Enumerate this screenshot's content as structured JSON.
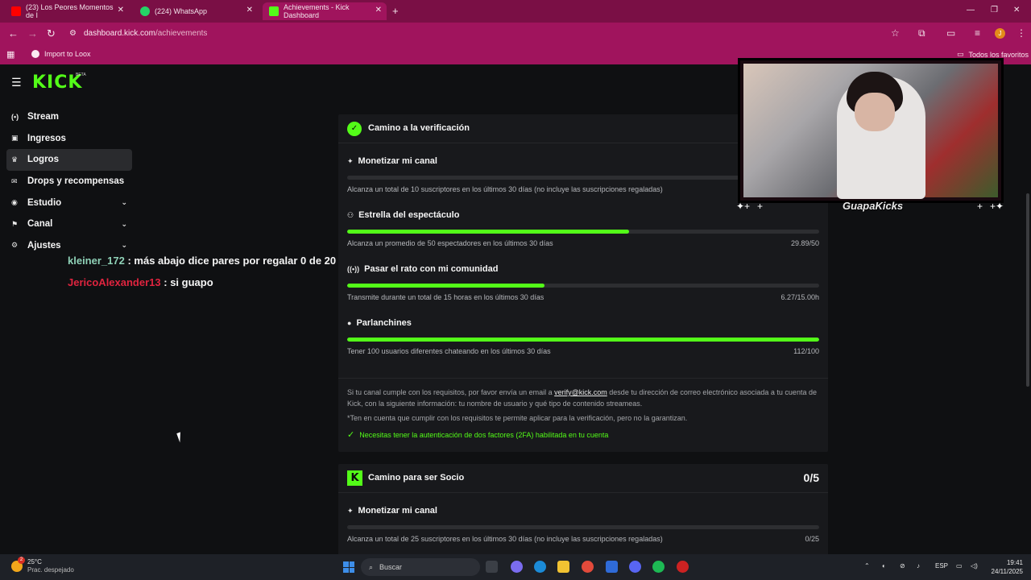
{
  "browser": {
    "tabs": [
      {
        "title": "(23) Los Peores Momentos de I",
        "icon": "youtube-icon"
      },
      {
        "title": "(224) WhatsApp",
        "icon": "whatsapp-icon"
      },
      {
        "title": "Achievements - Kick Dashboard",
        "icon": "kick-icon"
      }
    ],
    "new_tab": "+",
    "url_domain": "dashboard.kick.com",
    "url_path": "/achievements",
    "profile_initial": "J",
    "bookmarks": {
      "import": "Import to Loox",
      "all": "Todos los favoritos"
    }
  },
  "kick": {
    "logo": "KICK",
    "beta": "BETA",
    "sidebar": [
      {
        "label": "Stream",
        "icon": "stream-icon"
      },
      {
        "label": "Ingresos",
        "icon": "revenue-icon"
      },
      {
        "label": "Logros",
        "icon": "trophy-icon",
        "active": true
      },
      {
        "label": "Drops y recompensas",
        "icon": "gift-icon"
      },
      {
        "label": "Estudio",
        "icon": "studio-icon",
        "expandable": true
      },
      {
        "label": "Canal",
        "icon": "channel-icon",
        "expandable": true
      },
      {
        "label": "Ajustes",
        "icon": "settings-icon",
        "expandable": true
      }
    ]
  },
  "chat": [
    {
      "user": "kleiner_172",
      "separator": " : ",
      "message": "más abajo dice pares por regalar 0 de 20"
    },
    {
      "user": "JericoAlexander13",
      "separator": " : ",
      "message": "si guapo"
    }
  ],
  "verification": {
    "title": "Camino a la verificación",
    "achievements": [
      {
        "title": "Monetizar mi canal",
        "desc": "Alcanza un total de 10 suscriptores en los últimos 30 días (no incluye las suscripciones regaladas)",
        "value": "",
        "progress": 0
      },
      {
        "title": "Estrella del espectáculo",
        "desc": "Alcanza un promedio de 50 espectadores en los últimos 30 días",
        "value": "29.89/50",
        "progress": 0.598
      },
      {
        "title": "Pasar el rato con mi comunidad",
        "desc": "Transmite durante un total de 15 horas en los últimos 30 días",
        "value": "6.27/15.00h",
        "progress": 0.418
      },
      {
        "title": "Parlanchines",
        "desc": "Tener 100 usuarios diferentes chateando en los últimos 30 días",
        "value": "112/100",
        "progress": 1.0
      }
    ],
    "info_before_link": "Si tu canal cumple con los requisitos, por favor envía un email a ",
    "info_link": "verify@kick.com",
    "info_after_link": " desde tu dirección de correo electrónico asociada a tu cuenta de Kick, con la siguiente información: tu nombre de usuario y qué tipo de contenido streameas.",
    "note": "*Ten en cuenta que cumplir con los requisitos te permite aplicar para la verificación, pero no la garantizan.",
    "twofa": "Necesitas tener la autenticación de dos factores (2FA) habilitada en tu cuenta"
  },
  "partner": {
    "title": "Camino para ser Socio",
    "score": "0/5",
    "achievements": [
      {
        "title": "Monetizar mi canal",
        "desc": "Alcanza un total de 25 suscriptores en los últimos 30 días (no incluye las suscripciones regaladas)",
        "value": "0/25",
        "progress": 0
      }
    ]
  },
  "overlay": {
    "logo_text": "GuapaKicks"
  },
  "taskbar": {
    "temp": "25°C",
    "weather": "Prac. despejado",
    "weather_badge": "2",
    "search": "Buscar",
    "lang": "ESP",
    "time": "19:41",
    "date": "24/11/2025"
  }
}
